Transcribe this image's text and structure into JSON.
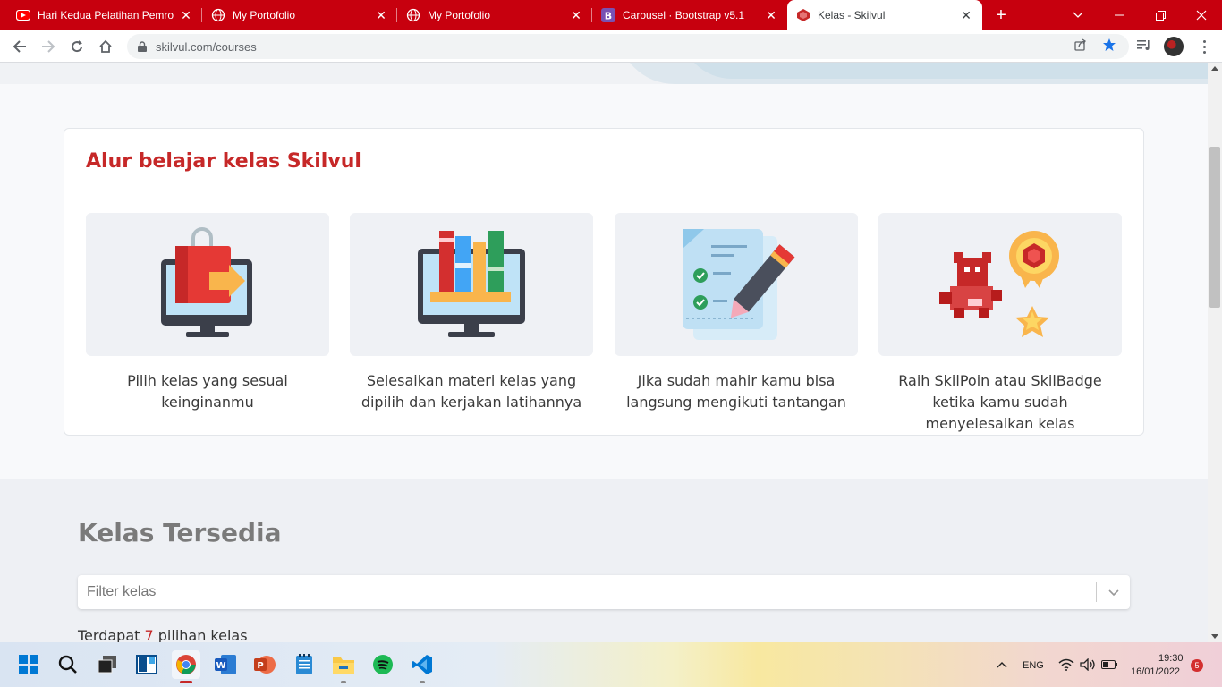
{
  "browser": {
    "tabs": [
      {
        "title": "Hari Kedua Pelatihan Pemrog",
        "favicon": "youtube-icon"
      },
      {
        "title": "My Portofolio",
        "favicon": "globe-icon"
      },
      {
        "title": "My Portofolio",
        "favicon": "globe-icon"
      },
      {
        "title": "Carousel · Bootstrap v5.1",
        "favicon": "bootstrap-icon"
      },
      {
        "title": "Kelas - Skilvul",
        "favicon": "skilvul-icon"
      }
    ],
    "active_tab": 4,
    "url": "skilvul.com/courses"
  },
  "page": {
    "learning_flow": {
      "title": "Alur belajar kelas Skilvul",
      "steps": [
        {
          "caption": "Pilih kelas yang sesuai keinginanmu",
          "icon": "shopping-bag-monitor-icon"
        },
        {
          "caption": "Selesaikan materi kelas yang dipilih dan kerjakan latihannya",
          "icon": "books-monitor-icon"
        },
        {
          "caption": "Jika sudah mahir kamu bisa langsung mengikuti tantangan",
          "icon": "checklist-pencil-icon"
        },
        {
          "caption": "Raih SkilPoin atau SkilBadge ketika kamu sudah menyelesaikan kelas",
          "icon": "badge-mascot-icon"
        }
      ]
    },
    "classes": {
      "title": "Kelas Tersedia",
      "filter_placeholder": "Filter kelas",
      "count_prefix": "Terdapat",
      "count": "7",
      "count_suffix": "pilihan kelas"
    }
  },
  "taskbar": {
    "apps": [
      "start-icon",
      "search-icon",
      "task-view-icon",
      "snap-icon",
      "chrome-icon",
      "word-icon",
      "powerpoint-icon",
      "notepad-icon",
      "file-explorer-icon",
      "spotify-icon",
      "vscode-icon"
    ],
    "language": "ENG",
    "time": "19:30",
    "date": "16/01/2022",
    "notifications": "5"
  },
  "colors": {
    "tab_bar": "#c7000e",
    "brand_red": "#c62828"
  }
}
